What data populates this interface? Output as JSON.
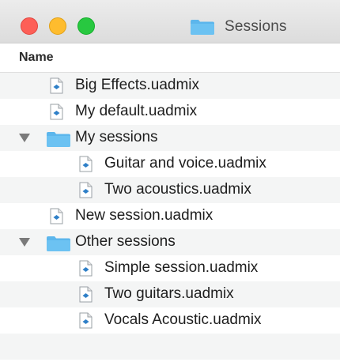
{
  "window": {
    "title": "Sessions",
    "title_icon": "folder-icon"
  },
  "columns": {
    "name_header": "Name"
  },
  "items": [
    {
      "label": "Big Effects.uadmix",
      "kind": "file",
      "level": 1
    },
    {
      "label": "My default.uadmix",
      "kind": "file",
      "level": 1
    },
    {
      "label": "My sessions",
      "kind": "folder",
      "level": 1,
      "expanded": true
    },
    {
      "label": "Guitar and voice.uadmix",
      "kind": "file",
      "level": 2
    },
    {
      "label": "Two acoustics.uadmix",
      "kind": "file",
      "level": 2
    },
    {
      "label": "New session.uadmix",
      "kind": "file",
      "level": 1
    },
    {
      "label": "Other sessions",
      "kind": "folder",
      "level": 1,
      "expanded": true
    },
    {
      "label": "Simple session.uadmix",
      "kind": "file",
      "level": 2
    },
    {
      "label": "Two guitars.uadmix",
      "kind": "file",
      "level": 2
    },
    {
      "label": "Vocals Acoustic.uadmix",
      "kind": "file",
      "level": 2
    }
  ],
  "colors": {
    "folder": "#5cb6ec",
    "stripe": "#f4f5f5",
    "close": "#fd5f57",
    "minimize": "#febc2e",
    "maximize": "#28c840"
  }
}
